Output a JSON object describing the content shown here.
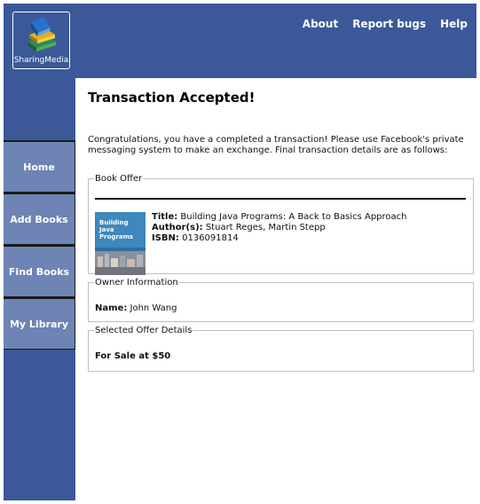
{
  "header": {
    "logo_text": "SharingMedia",
    "nav": [
      {
        "label": "About"
      },
      {
        "label": "Report bugs"
      },
      {
        "label": "Help"
      }
    ]
  },
  "sidebar": {
    "items": [
      {
        "label": "Home"
      },
      {
        "label": "Add Books"
      },
      {
        "label": "Find Books"
      },
      {
        "label": "My Library"
      }
    ]
  },
  "main": {
    "title": "Transaction Accepted!",
    "intro": "Congratulations, you have a completed a transaction! Please use Facebook's private messaging system to make an exchange. Final transaction details are as follows:",
    "book_offer": {
      "legend": "Book Offer",
      "title_label": "Title:",
      "title_value": " Building Java Programs: A Back to Basics Approach",
      "authors_label": "Author(s):",
      "authors_value": " Stuart Reges, Martin Stepp",
      "isbn_label": "ISBN:",
      "isbn_value": " 0136091814",
      "cover_text": [
        "Building",
        "Java",
        "Programs"
      ]
    },
    "owner": {
      "legend": "Owner Information",
      "name_label": "Name:",
      "name_value": " John Wang"
    },
    "offer": {
      "legend": "Selected Offer Details",
      "text": "For Sale at $50"
    }
  },
  "colors": {
    "brand": "#3b5998",
    "nav_button": "#6d84b4"
  }
}
